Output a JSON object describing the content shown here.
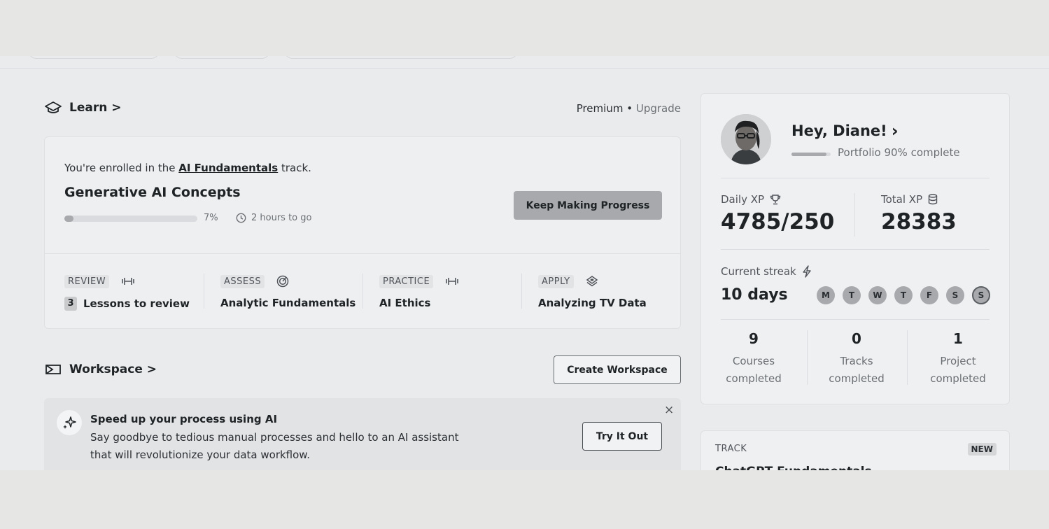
{
  "learn": {
    "heading": "Learn >",
    "plan": "Premium",
    "sep": "•",
    "upgrade": "Upgrade",
    "enrolled_prefix": "You're enrolled in the ",
    "enrolled_link": "AI Fundamentals",
    "enrolled_suffix": " track.",
    "course_title": "Generative AI Concepts",
    "progress_percent": 7,
    "progress_label": "7%",
    "time_left": "2 hours to go",
    "cta": "Keep Making Progress",
    "steps": [
      {
        "tag": "REVIEW",
        "icon": "dumbbell-icon",
        "count": "3",
        "value": "Lessons to review"
      },
      {
        "tag": "ASSESS",
        "icon": "radar-icon",
        "value": "Analytic Fundamentals"
      },
      {
        "tag": "PRACTICE",
        "icon": "dumbbell-icon",
        "value": "AI Ethics"
      },
      {
        "tag": "APPLY",
        "icon": "layers-icon",
        "value": "Analyzing TV Data"
      }
    ]
  },
  "workspace": {
    "heading": "Workspace >",
    "create_label": "Create Workspace",
    "banner": {
      "title": "Speed up your process using AI",
      "description": "Say goodbye to tedious manual processes and hello to an AI assistant that will revolutionize your data workflow.",
      "cta": "Try It Out",
      "close": "×"
    }
  },
  "profile": {
    "greeting": "Hey, Diane!",
    "greeting_chevron": "›",
    "portfolio_percent": 90,
    "portfolio_text": "Portfolio 90% complete",
    "daily_xp_label": "Daily XP",
    "daily_xp_value": "4785/250",
    "total_xp_label": "Total XP",
    "total_xp_value": "28383",
    "streak_label": "Current streak",
    "streak_value": "10 days",
    "days": [
      "M",
      "T",
      "W",
      "T",
      "F",
      "S",
      "S"
    ],
    "completed": [
      {
        "number": "9",
        "label1": "Courses",
        "label2": "completed"
      },
      {
        "number": "0",
        "label1": "Tracks",
        "label2": "completed"
      },
      {
        "number": "1",
        "label1": "Project",
        "label2": "completed"
      }
    ]
  },
  "track_card": {
    "tag": "TRACK",
    "badge": "NEW",
    "title": "ChatGPT Fundamentals"
  },
  "colors": {
    "page_bg": "#eaebed",
    "card_bg": "#eeeff1",
    "accent_gray": "#a7a9ac",
    "text_dark": "#1f2326"
  }
}
